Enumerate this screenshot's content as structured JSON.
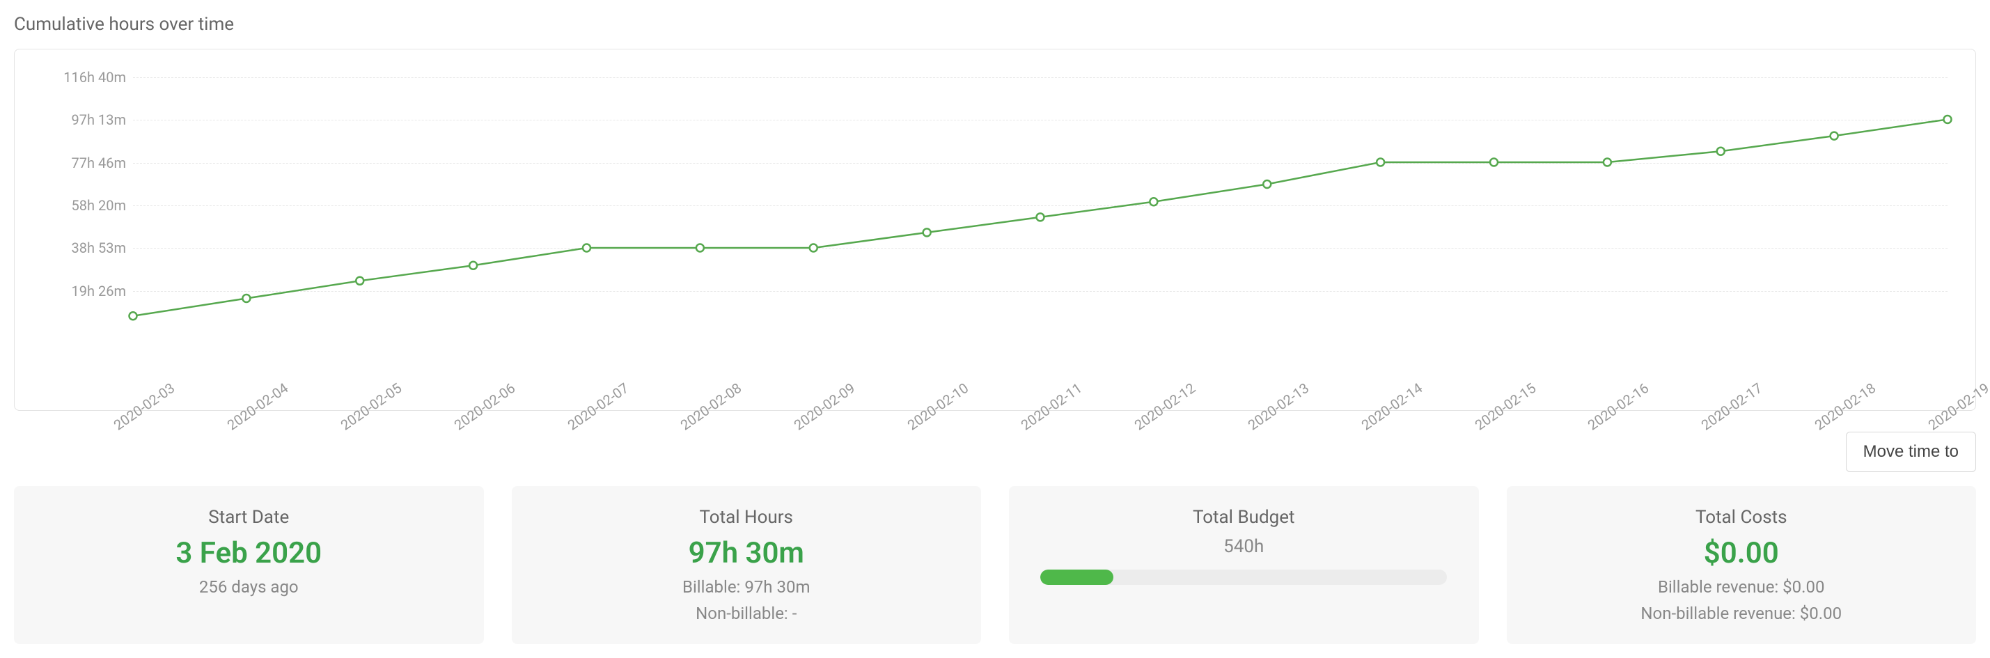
{
  "chart": {
    "title": "Cumulative hours over time",
    "y_ticks": [
      "19h 26m",
      "38h 53m",
      "58h 20m",
      "77h 46m",
      "97h 13m",
      "116h 40m"
    ],
    "x_labels": [
      "2020-02-03",
      "2020-02-04",
      "2020-02-05",
      "2020-02-06",
      "2020-02-07",
      "2020-02-08",
      "2020-02-09",
      "2020-02-10",
      "2020-02-11",
      "2020-02-12",
      "2020-02-13",
      "2020-02-14",
      "2020-02-15",
      "2020-02-16",
      "2020-02-17",
      "2020-02-18",
      "2020-02-19"
    ]
  },
  "chart_data": {
    "type": "line",
    "title": "Cumulative hours over time",
    "xlabel": "",
    "ylabel": "",
    "ylim": [
      0,
      116.67
    ],
    "categories": [
      "2020-02-03",
      "2020-02-04",
      "2020-02-05",
      "2020-02-06",
      "2020-02-07",
      "2020-02-08",
      "2020-02-09",
      "2020-02-10",
      "2020-02-11",
      "2020-02-12",
      "2020-02-13",
      "2020-02-14",
      "2020-02-15",
      "2020-02-16",
      "2020-02-17",
      "2020-02-18",
      "2020-02-19"
    ],
    "values": [
      8.0,
      16.0,
      24.0,
      31.0,
      39.0,
      39.0,
      39.0,
      46.0,
      53.0,
      60.0,
      68.0,
      78.0,
      78.0,
      78.0,
      83.0,
      90.0,
      97.5
    ]
  },
  "actions": {
    "move_time_to": "Move time to"
  },
  "stats": {
    "start_date": {
      "label": "Start Date",
      "value": "3 Feb 2020",
      "sub": "256 days ago"
    },
    "total_hours": {
      "label": "Total Hours",
      "value": "97h 30m",
      "billable": "Billable: 97h 30m",
      "nonbillable": "Non-billable: -"
    },
    "total_budget": {
      "label": "Total Budget",
      "value": "540h",
      "percent": 18
    },
    "total_costs": {
      "label": "Total Costs",
      "value": "$0.00",
      "billable": "Billable revenue: $0.00",
      "nonbillable": "Non-billable revenue: $0.00"
    }
  }
}
